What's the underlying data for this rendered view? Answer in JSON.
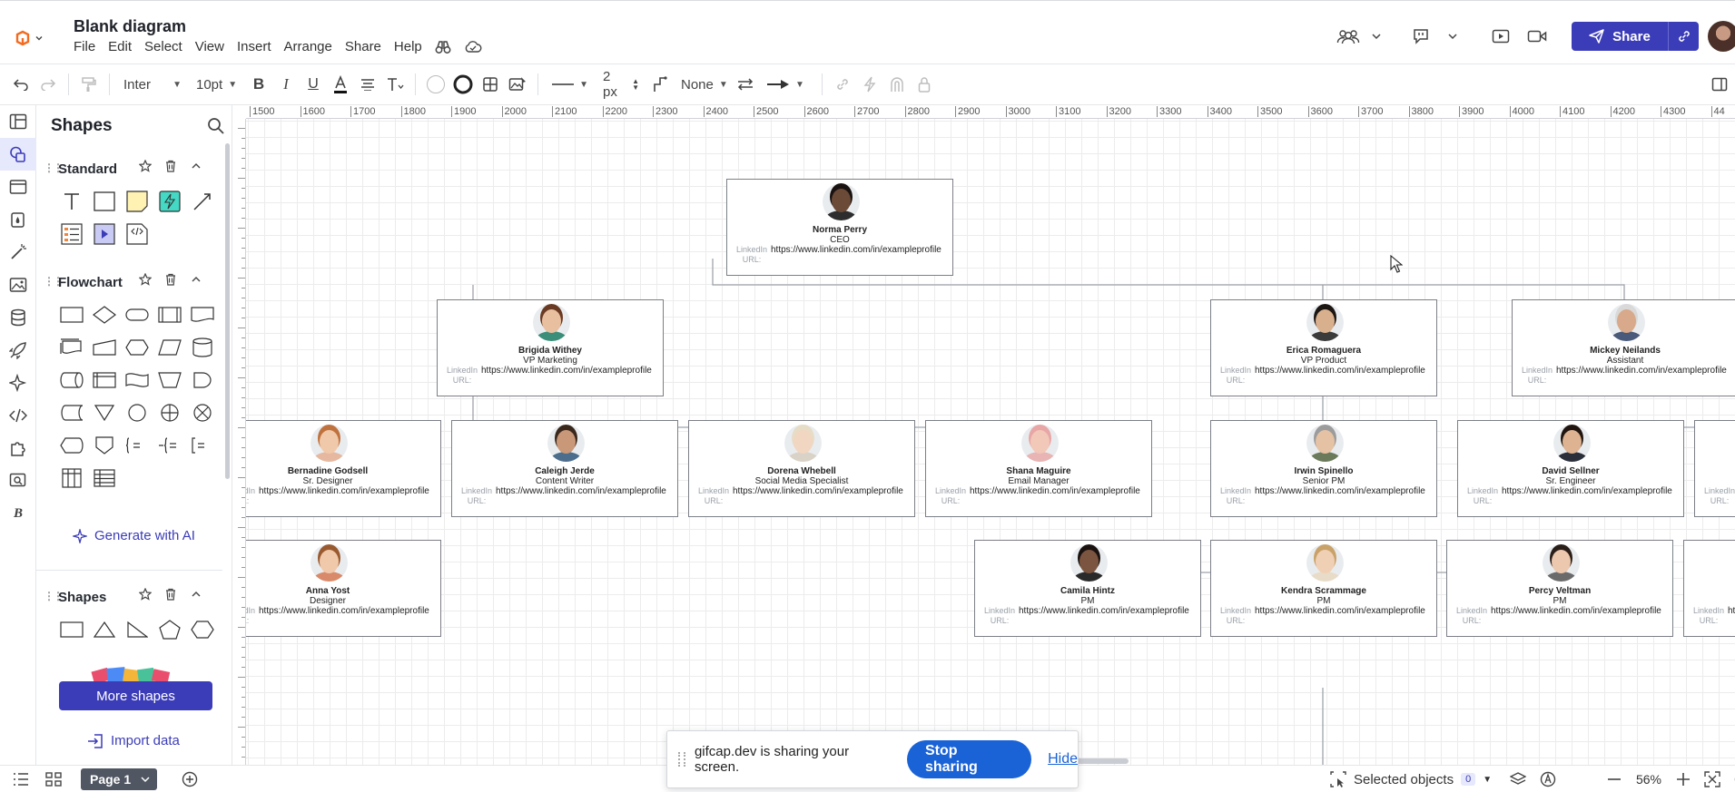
{
  "header": {
    "title": "Blank diagram",
    "menu": [
      "File",
      "Edit",
      "Select",
      "View",
      "Insert",
      "Arrange",
      "Share",
      "Help"
    ],
    "share_label": "Share"
  },
  "toolbar": {
    "font": "Inter",
    "font_size": "10pt",
    "line_width": "2 px",
    "line_start": "None"
  },
  "panel": {
    "title": "Shapes",
    "libraries": [
      {
        "name": "Standard"
      },
      {
        "name": "Flowchart"
      },
      {
        "name": "Shapes"
      }
    ],
    "generate_ai": "Generate with AI",
    "more_shapes": "More shapes",
    "import_data": "Import data"
  },
  "ruler": {
    "top_ticks": [
      "1500",
      "1600",
      "1700",
      "1800",
      "1900",
      "2000",
      "2100",
      "2200",
      "2300",
      "2400",
      "2500",
      "2600",
      "2700",
      "2800",
      "2900",
      "3000",
      "3100",
      "3200",
      "3300",
      "3400",
      "3500",
      "3600",
      "3700",
      "3800",
      "3900",
      "4000",
      "4100",
      "4200",
      "4300",
      "44"
    ]
  },
  "cards": [
    {
      "name": "Norma Perry",
      "role": "CEO"
    },
    {
      "name": "Brigida Withey",
      "role": "VP Marketing"
    },
    {
      "name": "Erica Romaguera",
      "role": "VP Product"
    },
    {
      "name": "Mickey Neilands",
      "role": "Assistant"
    },
    {
      "name": "Bernadine Godsell",
      "role": "Sr. Designer"
    },
    {
      "name": "Caleigh Jerde",
      "role": "Content Writer"
    },
    {
      "name": "Dorena Whebell",
      "role": "Social Media Specialist"
    },
    {
      "name": "Shana Maguire",
      "role": "Email Manager"
    },
    {
      "name": "Irwin Spinello",
      "role": "Senior PM"
    },
    {
      "name": "David Sellner",
      "role": "Sr. Engineer"
    },
    {
      "name": "",
      "role": ""
    },
    {
      "name": "Anna Yost",
      "role": "Designer"
    },
    {
      "name": "Camila Hintz",
      "role": "PM"
    },
    {
      "name": "Kendra Scrammage",
      "role": "PM"
    },
    {
      "name": "Percy Veltman",
      "role": "PM"
    },
    {
      "name": "",
      "role": ""
    }
  ],
  "card_labels": {
    "linkedin_label": "LinkedIn URL:",
    "url": "https://www.linkedin.com/in/exampleprofile"
  },
  "share_notice": {
    "message": "gifcap.dev is sharing your screen.",
    "stop": "Stop sharing",
    "hide": "Hide"
  },
  "statusbar": {
    "page": "Page 1",
    "selected_objects": "Selected objects",
    "selected_count": "0",
    "zoom": "56%"
  },
  "colors": {
    "brand": "#3b3cb8",
    "share_blue": "#1a63d6"
  }
}
